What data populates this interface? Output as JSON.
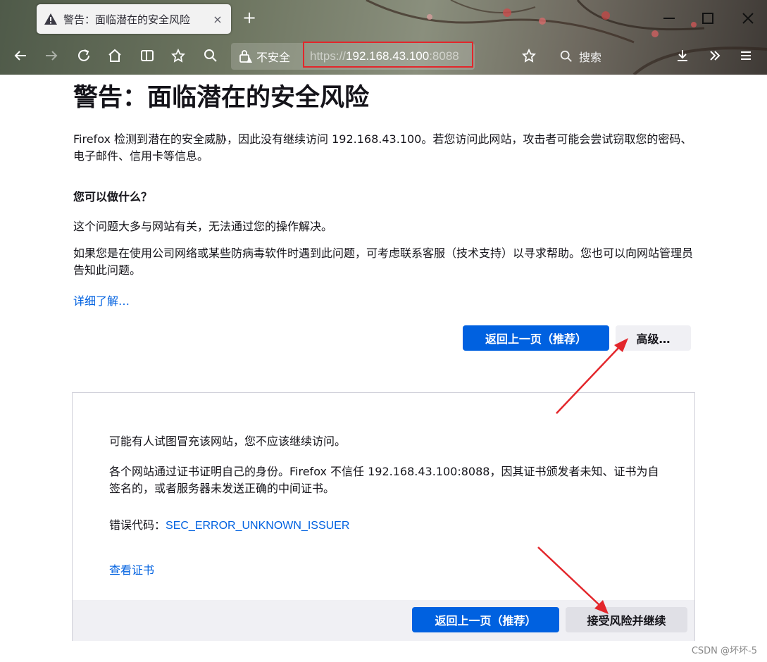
{
  "browser": {
    "tab": {
      "title": "警告：面临潜在的安全风险",
      "close": "×"
    },
    "new_tab": "+",
    "url": {
      "scheme": "https://",
      "host": "192.168.43.100",
      "port": ":8088"
    },
    "security_label": "不安全",
    "search_placeholder": "搜索",
    "highlight_color": "#e3262b"
  },
  "page": {
    "title": "警告：面临潜在的安全风险",
    "intro": "Firefox 检测到潜在的安全威胁，因此没有继续访问 192.168.43.100。若您访问此网站，攻击者可能会尝试窃取您的密码、电子邮件、信用卡等信息。",
    "what_heading": "您可以做什么？",
    "p1": "这个问题大多与网站有关，无法通过您的操作解决。",
    "p2": "如果您是在使用公司网络或某些防病毒软件时遇到此问题，可考虑联系客服（技术支持）以寻求帮助。您也可以向网站管理员告知此问题。",
    "learn_more": "详细了解…",
    "go_back": "返回上一页（推荐）",
    "advanced": "高级…"
  },
  "advanced_panel": {
    "p1": "可能有人试图冒充该网站，您不应该继续访问。",
    "p2": "各个网站通过证书证明自己的身份。Firefox 不信任 192.168.43.100:8088，因其证书颁发者未知、证书为自签名的，或者服务器未发送正确的中间证书。",
    "error_label": "错误代码：",
    "error_code": "SEC_ERROR_UNKNOWN_ISSUER",
    "view_cert": "查看证书",
    "go_back": "返回上一页（推荐）",
    "accept": "接受风险并继续"
  },
  "watermark": "CSDN @坏坏-5",
  "colors": {
    "primary": "#0061e0",
    "link": "#0061e0",
    "annotation": "#e3262b"
  }
}
